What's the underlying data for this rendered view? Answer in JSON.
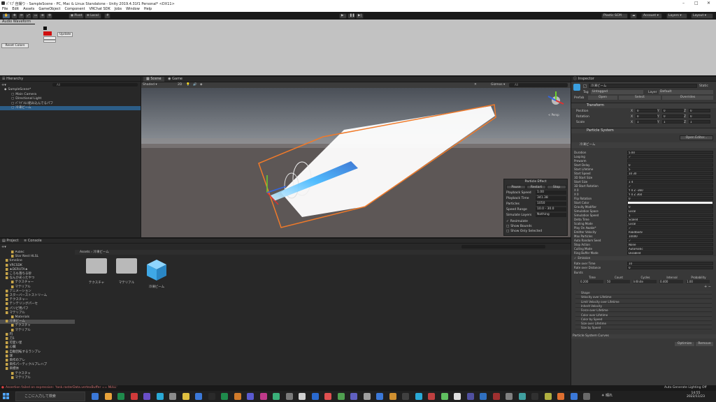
{
  "window": {
    "title": "ﾊﾟﾘﾌﾟ自撮り - SampleScene - PC, Mac & Linux Standalone - Unity 2019.4.31f1 Personal* <DX11>"
  },
  "menu": [
    "File",
    "Edit",
    "Assets",
    "GameObject",
    "Component",
    "VRChat SDK",
    "Jobs",
    "Window",
    "Help"
  ],
  "toolbar": {
    "pivot": "Pivot",
    "local": "Local",
    "plastic": "Plastic SCM",
    "account": "Account",
    "layers": "Layers",
    "layout": "Layout"
  },
  "audio": {
    "tab": "Audio Waveform",
    "update": "Update",
    "reset": "Reset Colors"
  },
  "hierarchy": {
    "tab": "Hierarchy",
    "search": "All",
    "items": [
      {
        "label": "SampleScene*",
        "indent": 0
      },
      {
        "label": "Main Camera",
        "indent": 1
      },
      {
        "label": "Directional Light",
        "indent": 1
      },
      {
        "label": "ﾊﾟﾘﾌﾟﾙに組み込んでるパフ",
        "indent": 1
      },
      {
        "label": "冷凍ビーム",
        "indent": 1,
        "selected": true
      }
    ]
  },
  "scene": {
    "tabs": [
      "Scene",
      "Game"
    ],
    "shading": "Shaded",
    "mode": "2D",
    "gizmos": "Gizmos",
    "search": "All",
    "persp": "< Persp"
  },
  "particle_effect": {
    "title": "Particle Effect",
    "buttons": [
      "Pause",
      "Restart",
      "Stop"
    ],
    "rows": [
      {
        "k": "Playback Speed",
        "v": "1.00"
      },
      {
        "k": "Playback Time",
        "v": "341.38"
      },
      {
        "k": "Particles",
        "v": "1050"
      },
      {
        "k": "Speed Range",
        "v": "10.0 - 30.0"
      },
      {
        "k": "Simulate Layers",
        "v": "Nothing"
      }
    ],
    "checks": [
      "Resimulate",
      "Show Bounds",
      "Show Only Selected"
    ]
  },
  "project": {
    "tabs": [
      "Project",
      "Console"
    ],
    "path": [
      "Assets",
      "冷凍ビーム"
    ],
    "tree": [
      {
        "l": "Public",
        "d": 1
      },
      {
        "l": "Star Nest HLSL",
        "d": 1
      },
      {
        "l": "timeline",
        "d": 0
      },
      {
        "l": "VRCSDK",
        "d": 0
      },
      {
        "l": "★DERUTA★",
        "d": 0
      },
      {
        "l": "ころも落ちる砂",
        "d": 0
      },
      {
        "l": "なんか光ったやつ",
        "d": 0
      },
      {
        "l": "テクスチャー",
        "d": 1
      },
      {
        "l": "マテリアル",
        "d": 1
      },
      {
        "l": "アニメーション",
        "d": 0
      },
      {
        "l": "スターバーストストリーム",
        "d": 0
      },
      {
        "l": "テクスチャー",
        "d": 0
      },
      {
        "l": "テンテリングパーセ",
        "d": 0
      },
      {
        "l": "パリピ用パフ",
        "d": 0
      },
      {
        "l": "マテリアル",
        "d": 0
      },
      {
        "l": "Materials",
        "d": 1
      },
      {
        "l": "冷凍ビーム",
        "d": 0,
        "sel": true
      },
      {
        "l": "テクスチャ",
        "d": 1
      },
      {
        "l": "マテリアル",
        "d": 1
      },
      {
        "l": "円",
        "d": 0
      },
      {
        "l": "刀1",
        "d": 0
      },
      {
        "l": "可愛い星",
        "d": 0
      },
      {
        "l": "心臓",
        "d": 0
      },
      {
        "l": "自動回転するランプレ",
        "d": 0
      },
      {
        "l": "球",
        "d": 0
      },
      {
        "l": "目作のアレ",
        "d": 0
      },
      {
        "l": "目作パーティクルプレハブ",
        "d": 0
      },
      {
        "l": "目標体",
        "d": 0
      },
      {
        "l": "テクスチャ",
        "d": 1
      },
      {
        "l": "マテリアル",
        "d": 1
      }
    ],
    "files": [
      "テクスチャ",
      "マテリアル",
      "冷凍ビーム"
    ]
  },
  "status": {
    "error": "Assertion failed on expression: 'task.rasterData.vertexBuffer == NULL'",
    "right": "Auto Generate Lighting Off"
  },
  "inspector": {
    "tab": "Inspector",
    "static": "Static",
    "name": "冷凍ビーム",
    "tag": "Untagged",
    "layer": "Default",
    "prefab": "Prefab",
    "open": "Open",
    "select": "Select",
    "overrides": "Overrides",
    "transform": {
      "title": "Transform",
      "rows": [
        {
          "k": "Position",
          "x": "0",
          "y": "0",
          "z": "0"
        },
        {
          "k": "Rotation",
          "x": "0",
          "y": "0",
          "z": "0"
        },
        {
          "k": "Scale",
          "x": "1",
          "y": "1",
          "z": "1"
        }
      ]
    },
    "ps_title": "Particle System",
    "open_editor": "Open Editor...",
    "ps_name": "冷凍ビーム",
    "props": [
      {
        "k": "Duration",
        "v": "5.00"
      },
      {
        "k": "Looping",
        "v": "✓"
      },
      {
        "k": "Prewarm",
        "v": ""
      },
      {
        "k": "Start Delay",
        "v": "0"
      },
      {
        "k": "Start Lifetime",
        "v": "5"
      },
      {
        "k": "Start Speed",
        "v": "10           30"
      },
      {
        "k": "3D Start Size",
        "v": ""
      },
      {
        "k": "Start Size",
        "v": "1            4"
      },
      {
        "k": "3D Start Rotation",
        "v": "✓"
      },
      {
        "k": "X 0",
        "v": "Y 0          Z -360"
      },
      {
        "k": "X 0",
        "v": "Y 0          Z 360"
      },
      {
        "k": "Flip Rotation",
        "v": "0"
      },
      {
        "k": "Start Color",
        "v": ""
      },
      {
        "k": "Gravity Modifier",
        "v": "0"
      },
      {
        "k": "Simulation Space",
        "v": "Local"
      },
      {
        "k": "Simulation Speed",
        "v": "1"
      },
      {
        "k": "Delta Time",
        "v": "Scaled"
      },
      {
        "k": "Scaling Mode",
        "v": "Local"
      },
      {
        "k": "Play On Awake*",
        "v": "✓"
      },
      {
        "k": "Emitter Velocity",
        "v": "Rigidbody"
      },
      {
        "k": "Max Particles",
        "v": "10000"
      },
      {
        "k": "Auto Random Seed",
        "v": "✓"
      },
      {
        "k": "Stop Action",
        "v": "None"
      },
      {
        "k": "Culling Mode",
        "v": "Automatic"
      },
      {
        "k": "Ring Buffer Mode",
        "v": "Disabled"
      }
    ],
    "emission": "Emission",
    "rate_time": {
      "k": "Rate over Time",
      "v": "10"
    },
    "rate_dist": {
      "k": "Rate over Distance",
      "v": "0"
    },
    "bursts": "Bursts",
    "burst_headers": [
      "Time",
      "Count",
      "Cycles",
      "Interval",
      "Probability"
    ],
    "burst_vals": [
      "0.200",
      "50",
      "Infinite",
      "0.400",
      "1.00"
    ],
    "modules": [
      "Shape",
      "Velocity over Lifetime",
      "Limit Velocity over Lifetime",
      "Inherit Velocity",
      "Force over Lifetime",
      "Color over Lifetime",
      "Color by Speed",
      "Size over Lifetime",
      "Size by Speed"
    ],
    "curves": "Particle System Curves",
    "optimize": "Optimize",
    "remove": "Remove"
  },
  "taskbar": {
    "search": "ここに入力して検索",
    "weather": "晴れ",
    "time": "14:55",
    "date": "2022/11/23"
  }
}
